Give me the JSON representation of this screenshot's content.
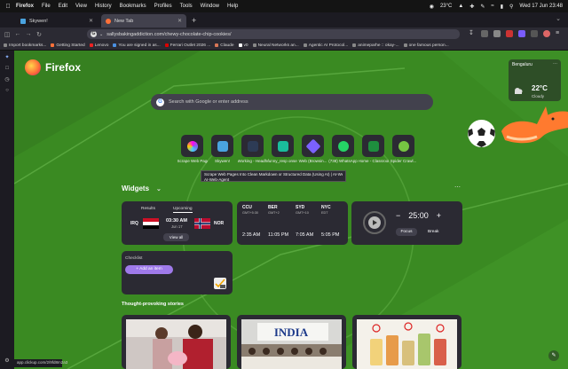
{
  "menubar": {
    "app": "Firefox",
    "items": [
      "File",
      "Edit",
      "View",
      "History",
      "Bookmarks",
      "Profiles",
      "Tools",
      "Window",
      "Help"
    ],
    "weather": "23°C",
    "datetime": "Wed 17 Jun  23:48"
  },
  "tabs": [
    {
      "title": "Skywen!",
      "active": false
    },
    {
      "title": "New Tab",
      "active": true
    }
  ],
  "urlbar": {
    "value": "sallysbakingaddiction.com/chewy-chocolate-chip-cookies/"
  },
  "bookmarks": [
    "Import bookmarks...",
    "Getting Started",
    "Lenovo",
    "You are signed in as...",
    "Ferrari Outlet 2026 ...",
    "Claude",
    "v0",
    "Neural Networks an...",
    "Agentic AI Protocol...",
    "animeparhe :: okay-...",
    "one famous person..."
  ],
  "firefox": {
    "name": "Firefox"
  },
  "weather": {
    "city": "Bengaluru",
    "temp": "22°C",
    "summary": "Cloudy"
  },
  "search": {
    "placeholder": "Search with Google or enter address"
  },
  "shortcuts": [
    {
      "label": "Scrape Web Pages Into...",
      "color": "#e8f0ff"
    },
    {
      "label": "Skywen!",
      "color": "#4aa3df"
    },
    {
      "label": "Working - Headhuntin...",
      "color": "#2d3b55"
    },
    {
      "label": "funny_resp onse | Ant...",
      "color": "#1abc9c"
    },
    {
      "label": "Web (Browsin...",
      "color": "#7b61ff"
    },
    {
      "label": "(738) WhatsApp",
      "color": "#25d366"
    },
    {
      "label": "Home - Classroom",
      "color": "#1e8e3e"
    },
    {
      "label": "Spider Crawl...",
      "color": "#76c442"
    }
  ],
  "tooltip": {
    "text": "Scrape Web Pages Into Clean Markdown or Structured Data (Using AI) | AI-Web-Agent",
    "sub": "AI-Web-Agent"
  },
  "widgets": {
    "title": "Widgets",
    "sports": {
      "tab_results": "Results",
      "tab_upcoming": "Upcoming",
      "home": "IRQ",
      "away": "NOR",
      "time": "03:30 AM",
      "date": "Jun 17",
      "view_all": "View all"
    },
    "clocks": [
      {
        "city": "CCU",
        "offset": "GMT+5:30",
        "time": "2:35 AM"
      },
      {
        "city": "BER",
        "offset": "GMT+2",
        "time": "11:05 PM"
      },
      {
        "city": "SYD",
        "offset": "GMT+10",
        "time": "7:05 AM"
      },
      {
        "city": "NYC",
        "offset": "EDT",
        "time": "5:05 PM"
      }
    ],
    "timer": {
      "minus": "−",
      "value": "25:00",
      "plus": "+",
      "focus": "Focus",
      "break": "Break"
    },
    "checklist": {
      "title": "Checklist",
      "add": "Add an item"
    }
  },
  "stories": {
    "title": "Thought-provoking stories",
    "india_text": "INDIA"
  },
  "status": {
    "text": "app.clickup.com/2/9fd8m2a3"
  },
  "colors": {
    "background_green": "#3a8a22",
    "accent_purple": "#9f7aea",
    "card": "#2b2a33"
  }
}
